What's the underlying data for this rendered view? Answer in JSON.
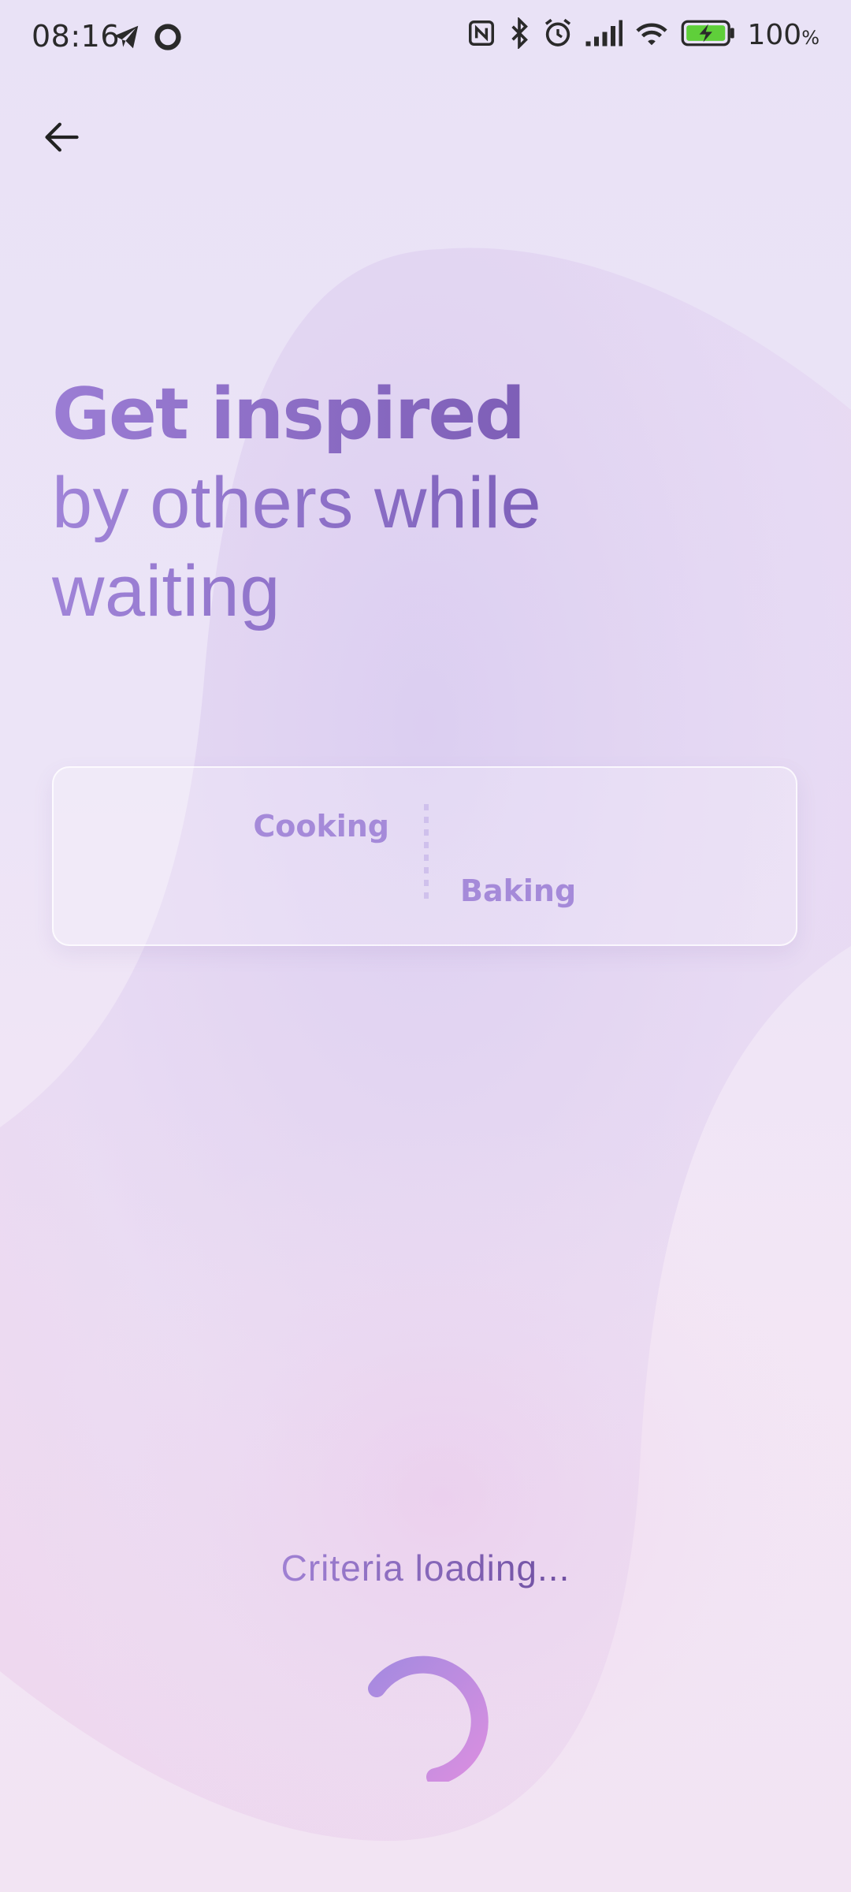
{
  "status_bar": {
    "time": "08:16",
    "battery_percent": "100",
    "battery_unit": "%",
    "left_icons": [
      "telegram-icon",
      "record-icon"
    ],
    "right_icons": [
      "nfc-icon",
      "bluetooth-icon",
      "alarm-icon",
      "signal-icon",
      "wifi-icon",
      "battery-charging-icon"
    ]
  },
  "header": {
    "back_icon": "arrow-left-icon"
  },
  "headline": {
    "bold": "Get inspired",
    "line2": "by others while",
    "line3": "waiting"
  },
  "categories": {
    "left": "Cooking",
    "right": "Baking"
  },
  "loading": {
    "text": "Criteria loading..."
  },
  "colors": {
    "accent": "#9b7dd4",
    "accent_dark": "#6f4fa8",
    "spinner_start": "#a68ae0",
    "spinner_end": "#d98fe0"
  }
}
